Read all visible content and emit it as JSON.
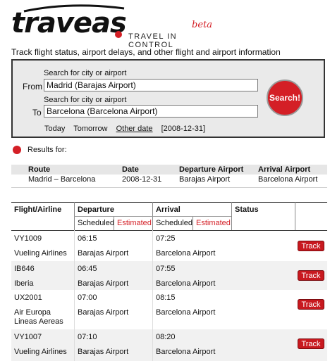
{
  "header": {
    "logo_text": "traveas",
    "beta": "beta",
    "tagline": "TRAVEL IN CONTROL"
  },
  "intro": "Track flight status, airport delays, and other flight and airport information",
  "search": {
    "from_hint": "Search for city or airport",
    "from_label": "From",
    "from_value": "Madrid (Barajas Airport)",
    "to_hint": "Search for city or airport",
    "to_label": "To",
    "to_value": "Barcelona (Barcelona Airport)",
    "button": "Search!",
    "date_today": "Today",
    "date_tomorrow": "Tomorrow",
    "date_other": "Other date",
    "date_selected": "[2008-12-31]"
  },
  "results_label": "Results for:",
  "route": {
    "headers": [
      "Route",
      "Date",
      "Departure Airport",
      "Arrival Airport"
    ],
    "row": [
      "Madrid – Barcelona",
      "2008-12-31",
      "Barajas Airport",
      "Barcelona Airport"
    ]
  },
  "flights": {
    "headers": {
      "flight": "Flight/Airline",
      "departure": "Departure",
      "arrival": "Arrival",
      "status": "Status",
      "scheduled": "Scheduled",
      "estimated": "Estimated"
    },
    "rows": [
      {
        "code": "VY1009",
        "airline": "Vueling Airlines",
        "dep_time": "06:15",
        "dep_airport": "Barajas Airport",
        "arr_time": "07:25",
        "arr_airport": "Barcelona Airport",
        "action": "Track"
      },
      {
        "code": "IB646",
        "airline": "Iberia",
        "dep_time": "06:45",
        "dep_airport": "Barajas Airport",
        "arr_time": "07:55",
        "arr_airport": "Barcelona Airport",
        "action": "Track"
      },
      {
        "code": "UX2001",
        "airline": "Air Europa Lineas Aereas",
        "dep_time": "07:00",
        "dep_airport": "Barajas Airport",
        "arr_time": "08:15",
        "arr_airport": "Barcelona Airport",
        "action": "Track"
      },
      {
        "code": "VY1007",
        "airline": "Vueling Airlines",
        "dep_time": "07:10",
        "dep_airport": "Barajas Airport",
        "arr_time": "08:20",
        "arr_airport": "Barcelona Airport",
        "action": "Track"
      }
    ]
  },
  "colors": {
    "accent": "#d41f26",
    "panel": "#eaeaea"
  }
}
